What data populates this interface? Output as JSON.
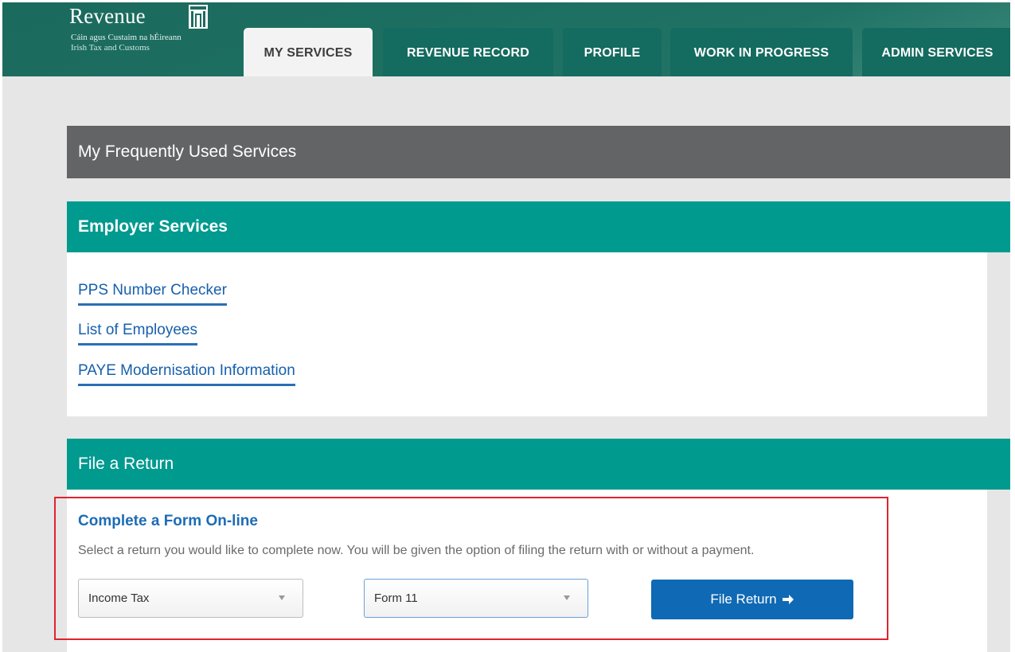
{
  "brand": {
    "name": "Revenue",
    "subtitle_irish": "Cáin agus Custaim na hÉireann",
    "subtitle_english": "Irish Tax and Customs"
  },
  "tabs": [
    {
      "label": "MY SERVICES",
      "active": true
    },
    {
      "label": "REVENUE RECORD",
      "active": false
    },
    {
      "label": "PROFILE",
      "active": false
    },
    {
      "label": "WORK IN PROGRESS",
      "active": false
    },
    {
      "label": "ADMIN SERVICES",
      "active": false
    }
  ],
  "frequent_services": {
    "title": "My Frequently Used Services"
  },
  "employer_services": {
    "title": "Employer Services",
    "links": [
      "PPS Number Checker",
      "List of Employees",
      "PAYE Modernisation Information"
    ]
  },
  "file_return": {
    "title": "File a Return",
    "form_title": "Complete a Form On-line",
    "description": "Select a return you would like to complete now. You will be given the option of filing the return with or without a payment.",
    "tax_type_select": "Income Tax",
    "form_select": "Form 11",
    "button_label": "File Return"
  },
  "colors": {
    "header_green": "#1d6b5f",
    "teal": "#009a8f",
    "dark_grey": "#626466",
    "link_blue": "#1660ad",
    "button_blue": "#0f69b4",
    "highlight_red": "#e0232f"
  }
}
